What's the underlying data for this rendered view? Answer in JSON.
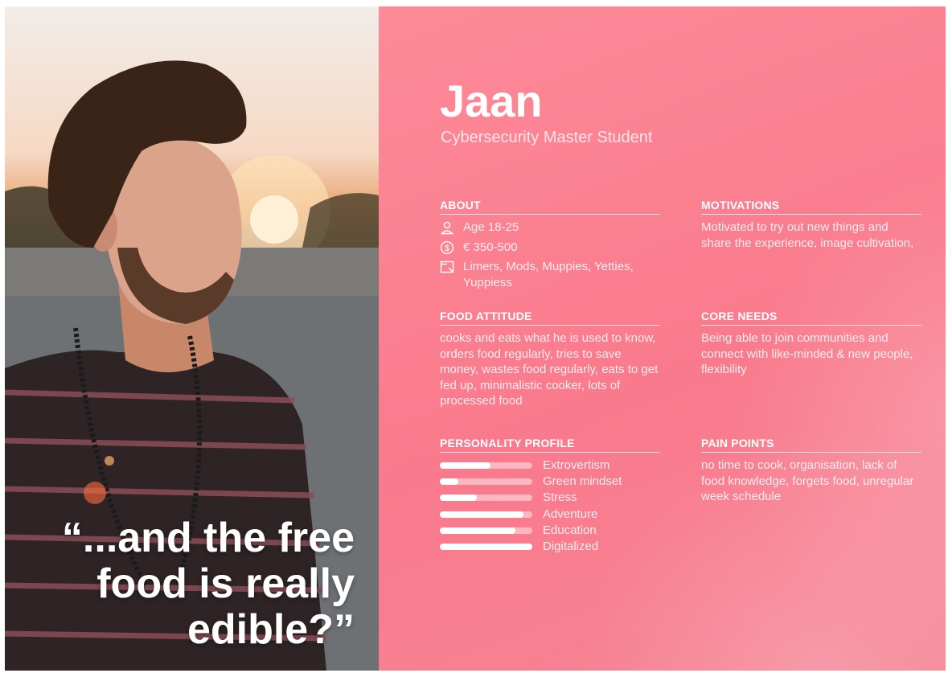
{
  "persona": {
    "name": "Jaan",
    "role": "Cybersecurity Master Student",
    "quote": "“...and the free food is really edible?”"
  },
  "about": {
    "title": "ABOUT",
    "items": [
      {
        "icon": "person-icon",
        "text": "Age 18-25"
      },
      {
        "icon": "dollar-icon",
        "text": "€ 350-500"
      },
      {
        "icon": "image-icon",
        "text": "Limers, Mods, Muppies, Yetties, Yuppiess"
      }
    ]
  },
  "motivations": {
    "title": "MOTIVATIONS",
    "text": "Motivated to try out new things and share the experience, image cultivation,"
  },
  "food_attitude": {
    "title": "FOOD ATTITUDE",
    "text": "cooks and eats what he is used to know, orders food regularly, tries to save money, wastes food regularly, eats to get fed up, minimalistic cooker, lots of processed food"
  },
  "core_needs": {
    "title": "CORE NEEDS",
    "text": "Being able to join communities and connect with like-minded & new people, flexibility"
  },
  "personality": {
    "title": "PERSONALITY PROFILE",
    "traits": [
      {
        "label": "Extrovertism",
        "level": 0.55
      },
      {
        "label": "Green mindset",
        "level": 0.2
      },
      {
        "label": "Stress",
        "level": 0.4
      },
      {
        "label": "Adventure",
        "level": 0.9
      },
      {
        "label": "Education",
        "level": 0.82
      },
      {
        "label": "Digitalized",
        "level": 1.0
      }
    ]
  },
  "pain_points": {
    "title": "PAIN POINTS",
    "text": "no time to cook, organisation, lack of food knowledge, forgets food, unregular week schedule"
  },
  "colors": {
    "panel_accent": "#f97a8c",
    "text": "#ffffff"
  }
}
